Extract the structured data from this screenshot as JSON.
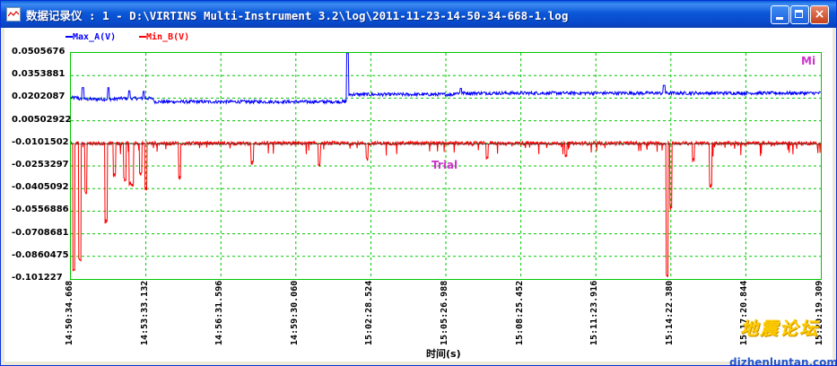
{
  "window": {
    "title": "数据记录仪 : 1 - D:\\VIRTINS Multi-Instrument 3.2\\log\\2011-11-23-14-50-34-668-1.log",
    "buttons": {
      "minimize": "minimize",
      "maximize": "maximize",
      "close": "×"
    }
  },
  "legend": {
    "series_a": "Max_A(V)",
    "series_b": "Min_B(V)",
    "color_a": "#0000ff",
    "color_b": "#ff0000"
  },
  "plot_labels": {
    "corner": "Mi",
    "trial": "Trial"
  },
  "watermark": {
    "text": "地震论坛",
    "url": "dizhenluntan.com"
  },
  "chart_data": {
    "type": "line",
    "xlabel": "时间(s)",
    "x_ticks": [
      "14:50:34.668",
      "14:53:33.132",
      "14:56:31.596",
      "14:59:30.060",
      "15:02:28.524",
      "15:05:26.988",
      "15:08:25.452",
      "15:11:23.916",
      "15:14:22.380",
      "15:17:20.844",
      "15:20:19.309"
    ],
    "y_ticks": [
      "0.0505676",
      "0.0353881",
      "0.0202087",
      "0.00502922",
      "-0.0101502",
      "-0.0253297",
      "-0.0405092",
      "-0.0556886",
      "-0.0708681",
      "-0.0860475",
      "-0.101227"
    ],
    "ylim": [
      -0.101227,
      0.0505676
    ],
    "grid": true,
    "series": [
      {
        "name": "Max_A(V)",
        "color": "#0000ff",
        "baseline_segments": [
          {
            "t_range": [
              0.0,
              0.01
            ],
            "value": 0.0205
          },
          {
            "t_range": [
              0.01,
              0.06
            ],
            "value": 0.0195
          },
          {
            "t_range": [
              0.06,
              0.11
            ],
            "value": 0.02
          },
          {
            "t_range": [
              0.11,
              0.37
            ],
            "value": 0.0178
          },
          {
            "t_range": [
              0.37,
              0.51
            ],
            "value": 0.0227
          },
          {
            "t_range": [
              0.51,
              1.0
            ],
            "value": 0.0236
          }
        ],
        "spikes": [
          {
            "t": 0.016,
            "value": 0.0272
          },
          {
            "t": 0.05,
            "value": 0.0272
          },
          {
            "t": 0.078,
            "value": 0.0251
          },
          {
            "t": 0.097,
            "value": 0.0247
          },
          {
            "t": 0.369,
            "value": 0.0505
          },
          {
            "t": 0.52,
            "value": 0.0268
          },
          {
            "t": 0.791,
            "value": 0.0288
          }
        ]
      },
      {
        "name": "Min_B(V)",
        "color": "#ff0000",
        "baseline": -0.0101,
        "dips": [
          {
            "t": 0.004,
            "value": -0.096
          },
          {
            "t": 0.012,
            "value": -0.09
          },
          {
            "t": 0.02,
            "value": -0.045
          },
          {
            "t": 0.047,
            "value": -0.064
          },
          {
            "t": 0.058,
            "value": -0.033
          },
          {
            "t": 0.072,
            "value": -0.036
          },
          {
            "t": 0.079,
            "value": -0.039
          },
          {
            "t": 0.082,
            "value": -0.039
          },
          {
            "t": 0.093,
            "value": -0.032
          },
          {
            "t": 0.1,
            "value": -0.042
          },
          {
            "t": 0.145,
            "value": -0.035
          },
          {
            "t": 0.242,
            "value": -0.025
          },
          {
            "t": 0.331,
            "value": -0.026
          },
          {
            "t": 0.395,
            "value": -0.022
          },
          {
            "t": 0.555,
            "value": -0.022
          },
          {
            "t": 0.66,
            "value": -0.02
          },
          {
            "t": 0.795,
            "value": -0.1
          },
          {
            "t": 0.8,
            "value": -0.055
          },
          {
            "t": 0.83,
            "value": -0.023
          },
          {
            "t": 0.853,
            "value": -0.04
          }
        ]
      }
    ]
  }
}
